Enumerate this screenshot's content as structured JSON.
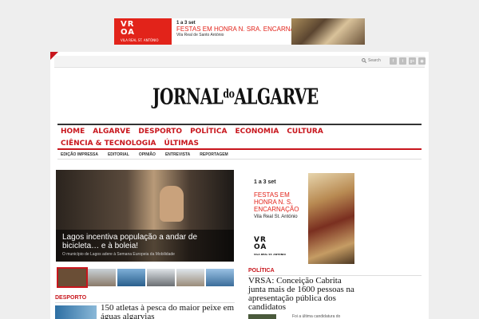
{
  "top_ad": {
    "logo_mark": "VR\nOA",
    "logo_sub": "VILA REAL ST. ANTÓNIO",
    "date": "1 a 3 set",
    "headline": "FESTAS EM HONRA N. SRA. ENCARNAÇÃO",
    "place": "Vila Real de Santo António"
  },
  "util_bar": {
    "search_label": "Search",
    "social_icons": [
      "facebook-icon",
      "twitter-icon",
      "googleplus-icon",
      "rss-icon"
    ]
  },
  "masthead": {
    "part1": "JORNAL",
    "part2": "do",
    "part3": "ALGARVE"
  },
  "nav": {
    "row1": [
      "HOME",
      "ALGARVE",
      "DESPORTO",
      "POLÍTICA",
      "ECONOMIA",
      "CULTURA"
    ],
    "row2": [
      "CIÊNCIA & TECNOLOGIA",
      "ÚLTIMAS"
    ]
  },
  "sub_nav": [
    "EDIÇÃO IMPRESSA",
    "EDITORIAL",
    "OPINIÃO",
    "ENTREVISTA",
    "REPORTAGEM"
  ],
  "featured": {
    "title": "Lagos incentiva população a andar de bicicleta… e à boleia!",
    "excerpt": "O município de Lagos adere à Semana Europeia da Mobilidade"
  },
  "side_ad": {
    "date": "1 a 3 set",
    "headline": "FESTAS EM HONRA N. S. ENCARNAÇÃO",
    "place": "Vila Real St. António",
    "logo_mark": "VR\nOA",
    "logo_sub": "VILA REAL ST. ANTÓNIO"
  },
  "politica": {
    "heading": "POLÍTICA",
    "title": "VRSA: Conceição Cabrita junta mais de 1600 pessoas na apresentação pública dos candidatos",
    "snippet": "Foi a última candidatura do"
  },
  "desporto": {
    "heading": "DESPORTO",
    "title": "150 atletas à pesca do maior peixe em águas algarvias"
  },
  "colors": {
    "accent": "#c8161d",
    "ad_red": "#e2231a"
  }
}
